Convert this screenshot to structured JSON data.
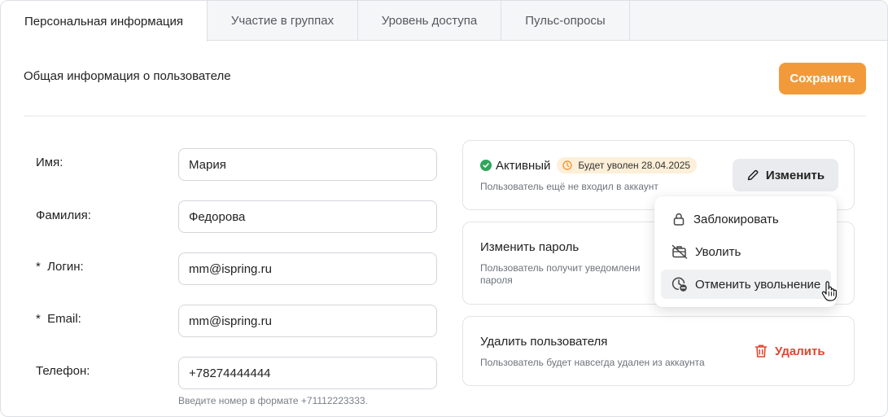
{
  "tabs": [
    {
      "label": "Персональная информация",
      "active": true
    },
    {
      "label": "Участие в группах",
      "active": false
    },
    {
      "label": "Уровень доступа",
      "active": false
    },
    {
      "label": "Пульс-опросы",
      "active": false
    }
  ],
  "section": {
    "title": "Общая информация о пользователе",
    "save_label": "Сохранить"
  },
  "form": {
    "first_name": {
      "label": "Имя:",
      "value": "Мария"
    },
    "last_name": {
      "label": "Фамилия:",
      "value": "Федорова"
    },
    "login": {
      "label": "*  Логин:",
      "value": "mm@ispring.ru"
    },
    "email": {
      "label": "*  Email:",
      "value": "mm@ispring.ru"
    },
    "phone": {
      "label": "Телефон:",
      "value": "+78274444444",
      "hint": "Введите номер в формате +71112223333."
    }
  },
  "status_card": {
    "status": "Активный",
    "badge": "Будет уволен 28.04.2025",
    "subtitle": "Пользователь ещё не входил в аккаунт",
    "edit_label": "Изменить"
  },
  "password_card": {
    "title": "Изменить пароль",
    "subtitle_line1": "Пользователь получит уведомлени",
    "subtitle_line2": "пароля"
  },
  "delete_card": {
    "title": "Удалить пользователя",
    "subtitle": "Пользователь будет навсегда удален из аккаунта",
    "delete_label": "Удалить"
  },
  "menu": {
    "items": [
      {
        "label": "Заблокировать",
        "icon": "lock-icon"
      },
      {
        "label": "Уволить",
        "icon": "briefcase-off-icon"
      },
      {
        "label": "Отменить увольнение",
        "icon": "clock-cancel-icon"
      }
    ]
  },
  "colors": {
    "accent": "#f29a3a",
    "success": "#2fa65a",
    "danger": "#e0452f",
    "badge_bg": "#fdefd8"
  }
}
